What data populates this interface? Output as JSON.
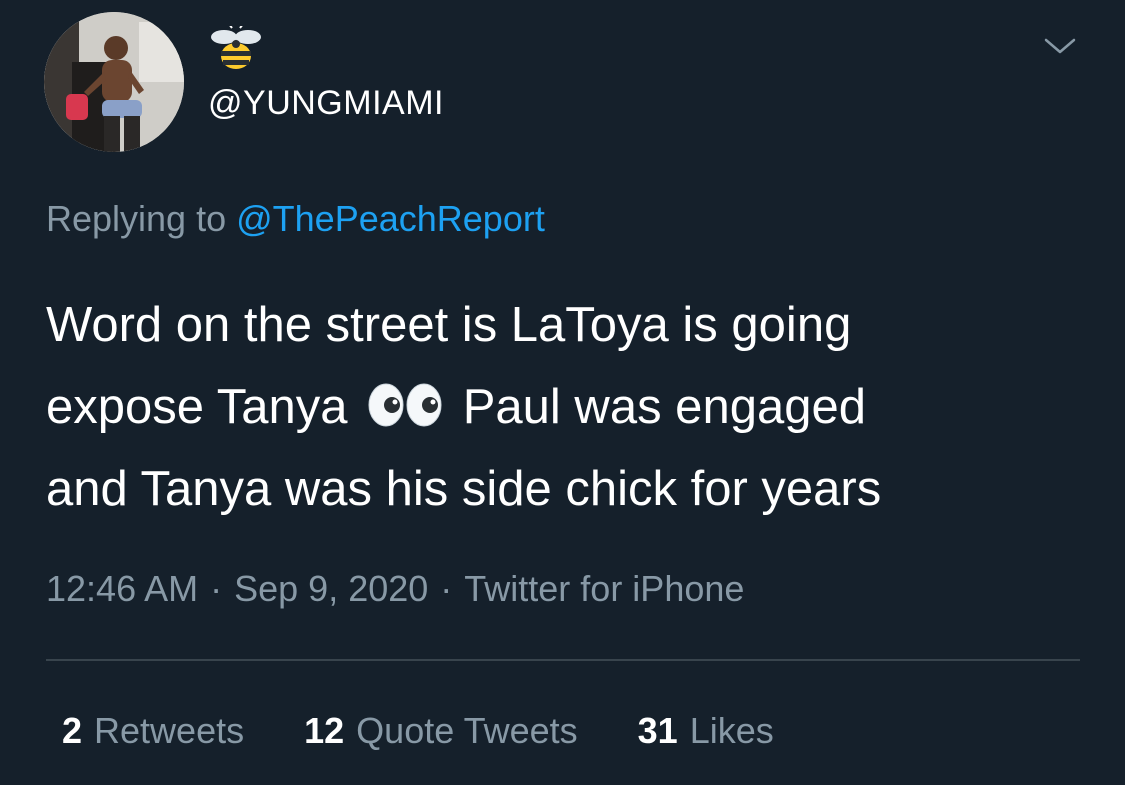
{
  "tweet": {
    "handle": "@YUNGMIAMI",
    "display_name_icon": "bee-icon",
    "avatar": "user-avatar",
    "menu_icon": "chevron-down-icon",
    "replying_prefix": "Replying to",
    "replying_to": "@ThePeachReport",
    "text_line1": "Word on the street is LaToya is going",
    "text_line2_a": "expose Tanya",
    "text_emoji": "eyes-emoji",
    "text_line2_b": "Paul was engaged",
    "text_line3": "and Tanya was his side chick for years",
    "time": "12:46 AM",
    "date": "Sep 9, 2020",
    "source": "Twitter for iPhone",
    "separator": "·"
  },
  "stats": {
    "retweets_count": "2",
    "retweets_label": "Retweets",
    "quotes_count": "12",
    "quotes_label": "Quote Tweets",
    "likes_count": "31",
    "likes_label": "Likes"
  },
  "colors": {
    "background": "#15202b",
    "text": "#ffffff",
    "secondary": "#8899a6",
    "accent": "#1da1f2",
    "divider": "#38444d"
  }
}
